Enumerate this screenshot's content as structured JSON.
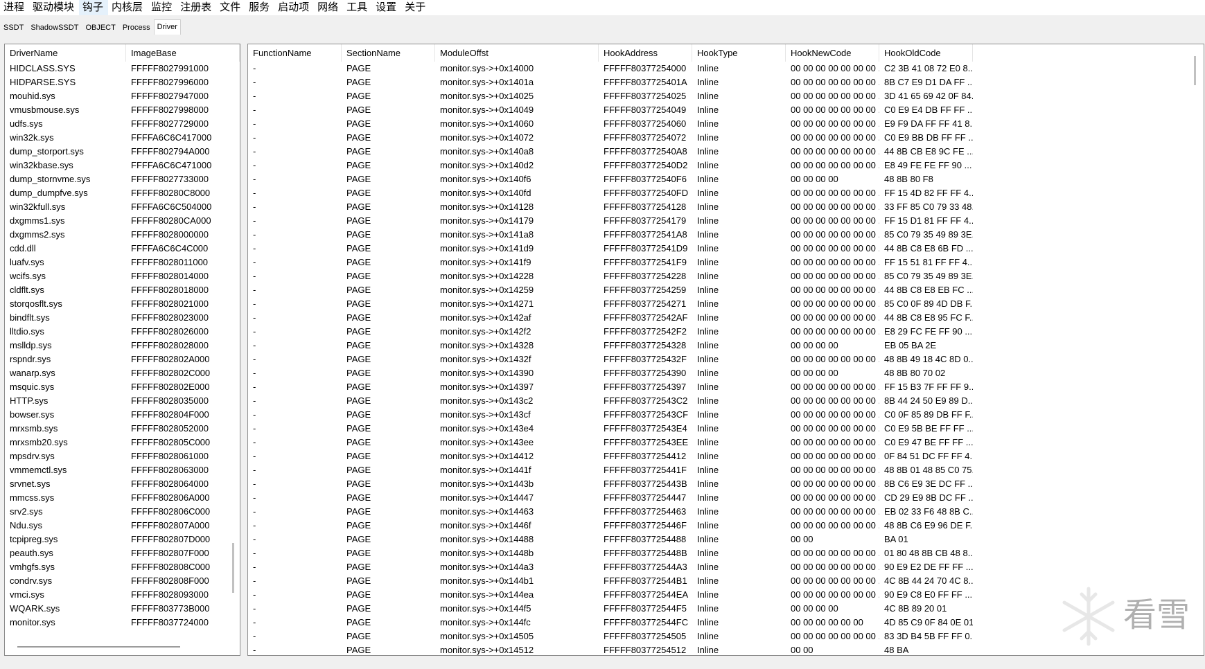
{
  "menu": [
    "进程",
    "驱动模块",
    "钩子",
    "内核层",
    "监控",
    "注册表",
    "文件",
    "服务",
    "启动项",
    "网络",
    "工具",
    "设置",
    "关于"
  ],
  "active_menu": "钩子",
  "tabs": [
    "SSDT",
    "ShadowSSDT",
    "OBJECT",
    "Process",
    "Driver"
  ],
  "active_tab": "Driver",
  "driver_table": {
    "columns": [
      "DriverName",
      "ImageBase"
    ],
    "rows": [
      [
        "HIDCLASS.SYS",
        "FFFFF8027991000"
      ],
      [
        "HIDPARSE.SYS",
        "FFFFF8027996000"
      ],
      [
        "mouhid.sys",
        "FFFFF8027947000"
      ],
      [
        "vmusbmouse.sys",
        "FFFFF8027998000"
      ],
      [
        "udfs.sys",
        "FFFFF8027729000"
      ],
      [
        "win32k.sys",
        "FFFFA6C6C417000"
      ],
      [
        "dump_storport.sys",
        "FFFFF802794A000"
      ],
      [
        "win32kbase.sys",
        "FFFFA6C6C471000"
      ],
      [
        "dump_stornvme.sys",
        "FFFFF8027733000"
      ],
      [
        "dump_dumpfve.sys",
        "FFFFF80280C8000"
      ],
      [
        "win32kfull.sys",
        "FFFFA6C6C504000"
      ],
      [
        "dxgmms1.sys",
        "FFFFF80280CA000"
      ],
      [
        "dxgmms2.sys",
        "FFFFF8028000000"
      ],
      [
        "cdd.dll",
        "FFFFA6C6C4C000"
      ],
      [
        "luafv.sys",
        "FFFFF8028011000"
      ],
      [
        "wcifs.sys",
        "FFFFF8028014000"
      ],
      [
        "cldflt.sys",
        "FFFFF8028018000"
      ],
      [
        "storqosflt.sys",
        "FFFFF8028021000"
      ],
      [
        "bindflt.sys",
        "FFFFF8028023000"
      ],
      [
        "lltdio.sys",
        "FFFFF8028026000"
      ],
      [
        "mslldp.sys",
        "FFFFF8028028000"
      ],
      [
        "rspndr.sys",
        "FFFFF802802A000"
      ],
      [
        "wanarp.sys",
        "FFFFF802802C000"
      ],
      [
        "msquic.sys",
        "FFFFF802802E000"
      ],
      [
        "HTTP.sys",
        "FFFFF8028035000"
      ],
      [
        "bowser.sys",
        "FFFFF802804F000"
      ],
      [
        "mrxsmb.sys",
        "FFFFF8028052000"
      ],
      [
        "mrxsmb20.sys",
        "FFFFF802805C000"
      ],
      [
        "mpsdrv.sys",
        "FFFFF8028061000"
      ],
      [
        "vmmemctl.sys",
        "FFFFF8028063000"
      ],
      [
        "srvnet.sys",
        "FFFFF8028064000"
      ],
      [
        "mmcss.sys",
        "FFFFF802806A000"
      ],
      [
        "srv2.sys",
        "FFFFF802806C000"
      ],
      [
        "Ndu.sys",
        "FFFFF802807A000"
      ],
      [
        "tcpipreg.sys",
        "FFFFF802807D000"
      ],
      [
        "peauth.sys",
        "FFFFF802807F000"
      ],
      [
        "vmhgfs.sys",
        "FFFFF802808C000"
      ],
      [
        "condrv.sys",
        "FFFFF802808F000"
      ],
      [
        "vmci.sys",
        "FFFFF8028093000"
      ],
      [
        "WQARK.sys",
        "FFFFF803773B000"
      ],
      [
        "monitor.sys",
        "FFFFF8037724000"
      ]
    ]
  },
  "hook_table": {
    "columns": [
      "FunctionName",
      "SectionName",
      "ModuleOffst",
      "HookAddress",
      "HookType",
      "HookNewCode",
      "HookOldCode"
    ],
    "rows": [
      [
        "-",
        "PAGE",
        "monitor.sys->+0x14000",
        "FFFFF80377254000",
        "Inline",
        "00 00 00 00 00 00 00 ...",
        "C2 3B 41 08 72 E0 8..."
      ],
      [
        "-",
        "PAGE",
        "monitor.sys->+0x1401a",
        "FFFFF8037725401A",
        "Inline",
        "00 00 00 00 00 00 00 ...",
        "8B C7 E9 D1 DA FF ..."
      ],
      [
        "-",
        "PAGE",
        "monitor.sys->+0x14025",
        "FFFFF80377254025",
        "Inline",
        "00 00 00 00 00 00 00 ...",
        "3D 41 65 69 42 0F 84..."
      ],
      [
        "-",
        "PAGE",
        "monitor.sys->+0x14049",
        "FFFFF80377254049",
        "Inline",
        "00 00 00 00 00 00 00 ...",
        "C0 E9 E4 DB FF FF ..."
      ],
      [
        "-",
        "PAGE",
        "monitor.sys->+0x14060",
        "FFFFF80377254060",
        "Inline",
        "00 00 00 00 00 00 00 ...",
        "E9 F9 DA FF FF 41 8..."
      ],
      [
        "-",
        "PAGE",
        "monitor.sys->+0x14072",
        "FFFFF80377254072",
        "Inline",
        "00 00 00 00 00 00 00 ...",
        "C0 E9 BB DB FF FF ..."
      ],
      [
        "-",
        "PAGE",
        "monitor.sys->+0x140a8",
        "FFFFF803772540A8",
        "Inline",
        "00 00 00 00 00 00 00 ...",
        "44 8B CB E8 9C FE ..."
      ],
      [
        "-",
        "PAGE",
        "monitor.sys->+0x140d2",
        "FFFFF803772540D2",
        "Inline",
        "00 00 00 00 00 00 00 ...",
        "E8 49 FE FE FF 90 ..."
      ],
      [
        "-",
        "PAGE",
        "monitor.sys->+0x140f6",
        "FFFFF803772540F6",
        "Inline",
        "00 00 00 00",
        "48 8B 80 F8"
      ],
      [
        "-",
        "PAGE",
        "monitor.sys->+0x140fd",
        "FFFFF803772540FD",
        "Inline",
        "00 00 00 00 00 00 00 ...",
        "FF 15 4D 82 FF FF 4..."
      ],
      [
        "-",
        "PAGE",
        "monitor.sys->+0x14128",
        "FFFFF80377254128",
        "Inline",
        "00 00 00 00 00 00 00 ...",
        "33 FF 85 C0 79 33 48..."
      ],
      [
        "-",
        "PAGE",
        "monitor.sys->+0x14179",
        "FFFFF80377254179",
        "Inline",
        "00 00 00 00 00 00 00 ...",
        "FF 15 D1 81 FF FF 4..."
      ],
      [
        "-",
        "PAGE",
        "monitor.sys->+0x141a8",
        "FFFFF803772541A8",
        "Inline",
        "00 00 00 00 00 00 00 ...",
        "85 C0 79 35 49 89 3E..."
      ],
      [
        "-",
        "PAGE",
        "monitor.sys->+0x141d9",
        "FFFFF803772541D9",
        "Inline",
        "00 00 00 00 00 00 00 ...",
        "44 8B C8 E8 6B FD ..."
      ],
      [
        "-",
        "PAGE",
        "monitor.sys->+0x141f9",
        "FFFFF803772541F9",
        "Inline",
        "00 00 00 00 00 00 00 ...",
        "FF 15 51 81 FF FF 4..."
      ],
      [
        "-",
        "PAGE",
        "monitor.sys->+0x14228",
        "FFFFF80377254228",
        "Inline",
        "00 00 00 00 00 00 00 ...",
        "85 C0 79 35 49 89 3E..."
      ],
      [
        "-",
        "PAGE",
        "monitor.sys->+0x14259",
        "FFFFF80377254259",
        "Inline",
        "00 00 00 00 00 00 00 ...",
        "44 8B C8 E8 EB FC ..."
      ],
      [
        "-",
        "PAGE",
        "monitor.sys->+0x14271",
        "FFFFF80377254271",
        "Inline",
        "00 00 00 00 00 00 00 ...",
        "85 C0 0F 89 4D DB F..."
      ],
      [
        "-",
        "PAGE",
        "monitor.sys->+0x142af",
        "FFFFF803772542AF",
        "Inline",
        "00 00 00 00 00 00 00 ...",
        "44 8B C8 E8 95 FC F..."
      ],
      [
        "-",
        "PAGE",
        "monitor.sys->+0x142f2",
        "FFFFF803772542F2",
        "Inline",
        "00 00 00 00 00 00 00 ...",
        "E8 29 FC FE FF 90 ..."
      ],
      [
        "-",
        "PAGE",
        "monitor.sys->+0x14328",
        "FFFFF80377254328",
        "Inline",
        "00 00 00 00",
        "EB 05 BA 2E"
      ],
      [
        "-",
        "PAGE",
        "monitor.sys->+0x1432f",
        "FFFFF8037725432F",
        "Inline",
        "00 00 00 00 00 00 00 ...",
        "48 8B 49 18 4C 8D 0..."
      ],
      [
        "-",
        "PAGE",
        "monitor.sys->+0x14390",
        "FFFFF80377254390",
        "Inline",
        "00 00 00 00",
        "48 8B 80 70 02"
      ],
      [
        "-",
        "PAGE",
        "monitor.sys->+0x14397",
        "FFFFF80377254397",
        "Inline",
        "00 00 00 00 00 00 00 ...",
        "FF 15 B3 7F FF FF 9..."
      ],
      [
        "-",
        "PAGE",
        "monitor.sys->+0x143c2",
        "FFFFF803772543C2",
        "Inline",
        "00 00 00 00 00 00 00 ...",
        "8B 44 24 50 E9 89 D..."
      ],
      [
        "-",
        "PAGE",
        "monitor.sys->+0x143cf",
        "FFFFF803772543CF",
        "Inline",
        "00 00 00 00 00 00 00 ...",
        "C0 0F 85 89 DB FF F..."
      ],
      [
        "-",
        "PAGE",
        "monitor.sys->+0x143e4",
        "FFFFF803772543E4",
        "Inline",
        "00 00 00 00 00 00 00 ...",
        "C0 E9 5B BE FF FF ..."
      ],
      [
        "-",
        "PAGE",
        "monitor.sys->+0x143ee",
        "FFFFF803772543EE",
        "Inline",
        "00 00 00 00 00 00 00 ...",
        "C0 E9 47 BE FF FF ..."
      ],
      [
        "-",
        "PAGE",
        "monitor.sys->+0x14412",
        "FFFFF80377254412",
        "Inline",
        "00 00 00 00 00 00 00 ...",
        "0F 84 51 DC FF FF 4..."
      ],
      [
        "-",
        "PAGE",
        "monitor.sys->+0x1441f",
        "FFFFF8037725441F",
        "Inline",
        "00 00 00 00 00 00 00 ...",
        "48 8B 01 48 85 C0 75..."
      ],
      [
        "-",
        "PAGE",
        "monitor.sys->+0x1443b",
        "FFFFF8037725443B",
        "Inline",
        "00 00 00 00 00 00 00 ...",
        "8B C6 E9 3E DC FF ..."
      ],
      [
        "-",
        "PAGE",
        "monitor.sys->+0x14447",
        "FFFFF80377254447",
        "Inline",
        "00 00 00 00 00 00 00 ...",
        "CD 29 E9 8B DC FF ..."
      ],
      [
        "-",
        "PAGE",
        "monitor.sys->+0x14463",
        "FFFFF80377254463",
        "Inline",
        "00 00 00 00 00 00 00 ...",
        "EB 02 33 F6 48 8B C..."
      ],
      [
        "-",
        "PAGE",
        "monitor.sys->+0x1446f",
        "FFFFF8037725446F",
        "Inline",
        "00 00 00 00 00 00 00 ...",
        "48 8B C6 E9 96 DE F..."
      ],
      [
        "-",
        "PAGE",
        "monitor.sys->+0x14488",
        "FFFFF80377254488",
        "Inline",
        "00 00",
        "BA 01"
      ],
      [
        "-",
        "PAGE",
        "monitor.sys->+0x1448b",
        "FFFFF8037725448B",
        "Inline",
        "00 00 00 00 00 00 00 ...",
        "01 80 48 8B CB 48 8..."
      ],
      [
        "-",
        "PAGE",
        "monitor.sys->+0x144a3",
        "FFFFF803772544A3",
        "Inline",
        "00 00 00 00 00 00 00 ...",
        "90 E9 E2 DE FF FF ..."
      ],
      [
        "-",
        "PAGE",
        "monitor.sys->+0x144b1",
        "FFFFF803772544B1",
        "Inline",
        "00 00 00 00 00 00 00 ...",
        "4C 8B 44 24 70 4C 8..."
      ],
      [
        "-",
        "PAGE",
        "monitor.sys->+0x144ea",
        "FFFFF803772544EA",
        "Inline",
        "00 00 00 00 00 00 00 ...",
        "90 E9 C8 E0 FF FF ..."
      ],
      [
        "-",
        "PAGE",
        "monitor.sys->+0x144f5",
        "FFFFF803772544F5",
        "Inline",
        "00 00 00 00",
        "4C 8B 89 20 01"
      ],
      [
        "-",
        "PAGE",
        "monitor.sys->+0x144fc",
        "FFFFF803772544FC",
        "Inline",
        "00 00 00 00 00 00",
        "4D 85 C9 0F 84 0E 01"
      ],
      [
        "-",
        "PAGE",
        "monitor.sys->+0x14505",
        "FFFFF80377254505",
        "Inline",
        "00 00 00 00 00 00 00 ...",
        "83 3D B4 5B FF FF 0..."
      ],
      [
        "-",
        "PAGE",
        "monitor.sys->+0x14512",
        "FFFFF80377254512",
        "Inline",
        "00 00",
        "48 BA"
      ]
    ]
  },
  "watermark_text": "看雪"
}
